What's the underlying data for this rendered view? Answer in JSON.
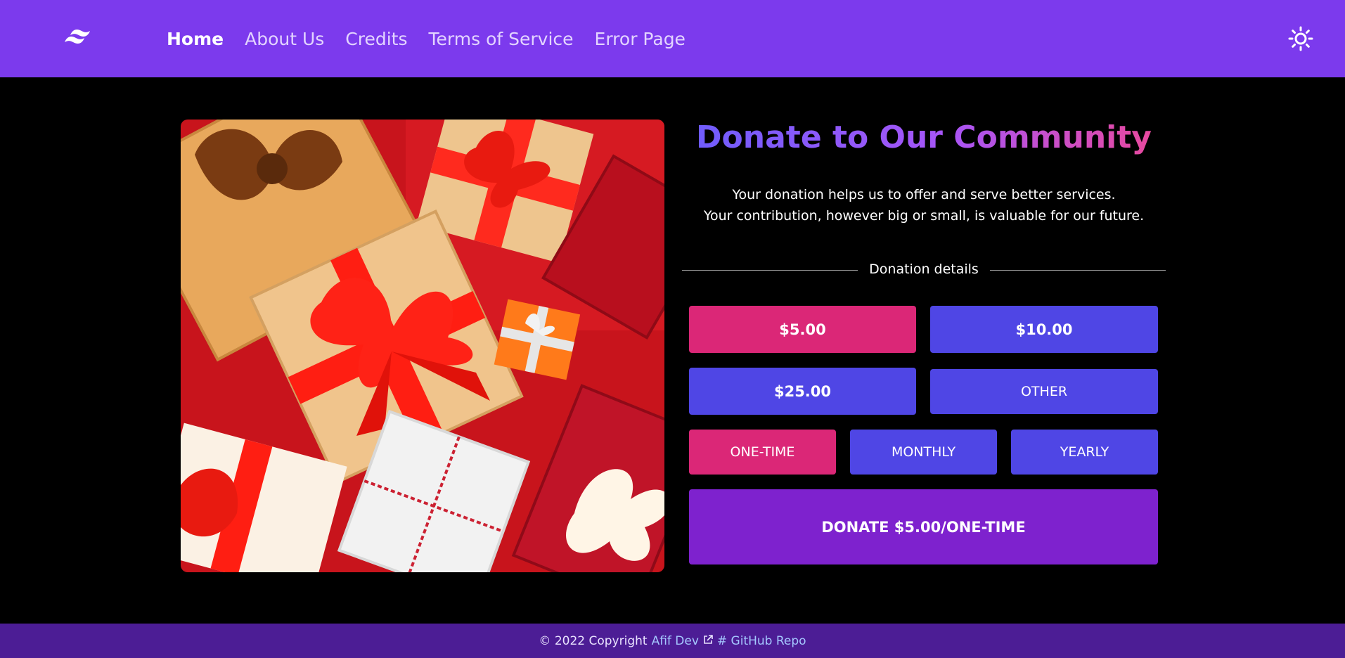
{
  "nav": {
    "logo_icon": "tailwind-logo-icon",
    "items": [
      {
        "label": "Home",
        "active": true
      },
      {
        "label": "About Us",
        "active": false
      },
      {
        "label": "Credits",
        "active": false
      },
      {
        "label": "Terms of Service",
        "active": false
      },
      {
        "label": "Error Page",
        "active": false
      }
    ],
    "theme_icon": "sun-icon"
  },
  "hero_image": {
    "subject": "gift boxes",
    "icon": "gift-boxes-photo"
  },
  "donation": {
    "title": "Donate to Our Community",
    "description_line1": "Your donation helps us to offer and serve better services.",
    "description_line2": "Your contribution, however big or small, is valuable for our future.",
    "details_label": "Donation details",
    "amounts": [
      {
        "label": "$5.00",
        "selected": true
      },
      {
        "label": "$10.00",
        "selected": false
      },
      {
        "label": "$25.00",
        "selected": false
      },
      {
        "label": "OTHER",
        "selected": false
      }
    ],
    "frequencies": [
      {
        "label": "ONE-TIME",
        "selected": true
      },
      {
        "label": "MONTHLY",
        "selected": false
      },
      {
        "label": "YEARLY",
        "selected": false
      }
    ],
    "donate_label": "DONATE $5.00/ONE-TIME"
  },
  "footer": {
    "copyright": "© 2022 Copyright",
    "author": "Afif Dev",
    "external_icon": "external-link-icon",
    "repo": "# GitHub Repo"
  },
  "colors": {
    "header": "#7c3aed",
    "selected": "#db2777",
    "button": "#4f46e5",
    "donate": "#7e22ce",
    "footer": "#4c1d95"
  }
}
